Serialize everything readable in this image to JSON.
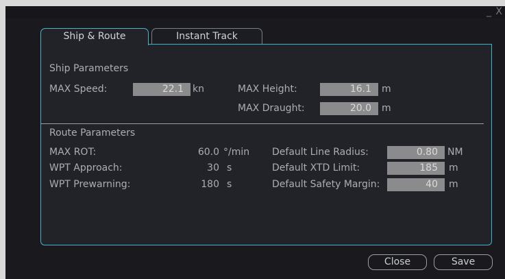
{
  "window": {
    "controls": "_ X"
  },
  "tabs": [
    {
      "label": "Ship & Route"
    },
    {
      "label": "Instant Track"
    }
  ],
  "ship": {
    "heading": "Ship Parameters",
    "max_speed_label": "MAX Speed:",
    "max_speed_value": "22.1",
    "max_speed_unit": "kn",
    "max_height_label": "MAX Height:",
    "max_height_value": "16.1",
    "max_height_unit": "m",
    "max_draught_label": "MAX Draught:",
    "max_draught_value": "20.0",
    "max_draught_unit": "m"
  },
  "route": {
    "heading": "Route Parameters",
    "max_rot_label": "MAX ROT:",
    "max_rot_value": "60.0",
    "max_rot_unit": "°/min",
    "wpt_approach_label": "WPT Approach:",
    "wpt_approach_value": "30",
    "wpt_approach_unit": "s",
    "wpt_prewarning_label": "WPT Prewarning:",
    "wpt_prewarning_value": "180",
    "wpt_prewarning_unit": "s",
    "line_radius_label": "Default Line Radius:",
    "line_radius_value": "0.80",
    "line_radius_unit": "NM",
    "xtd_limit_label": "Default XTD Limit:",
    "xtd_limit_value": "185",
    "xtd_limit_unit": "m",
    "safety_margin_label": "Default Safety Margin:",
    "safety_margin_value": "40",
    "safety_margin_unit": "m"
  },
  "buttons": {
    "close": "Close",
    "save": "Save"
  }
}
